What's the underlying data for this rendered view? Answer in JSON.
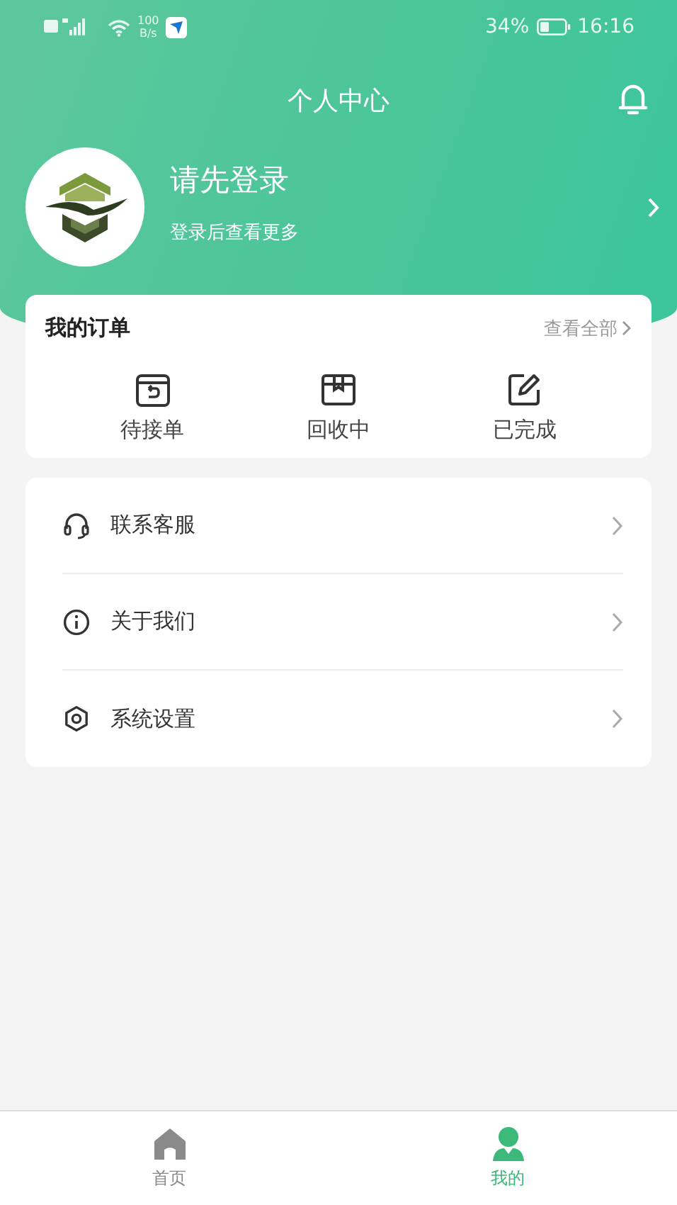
{
  "status_bar": {
    "speed": "100",
    "speed_unit": "B/s",
    "battery": "34%",
    "time": "16:16"
  },
  "header": {
    "title": "个人中心"
  },
  "profile": {
    "name": "请先登录",
    "hint": "登录后查看更多"
  },
  "orders": {
    "title": "我的订单",
    "view_all": "查看全部",
    "items": [
      {
        "label": "待接单",
        "kind": "pending"
      },
      {
        "label": "回收中",
        "kind": "package"
      },
      {
        "label": "已完成",
        "kind": "done"
      }
    ]
  },
  "menu": [
    {
      "label": "联系客服",
      "kind": "headset"
    },
    {
      "label": "关于我们",
      "kind": "info"
    },
    {
      "label": "系统设置",
      "kind": "gear"
    }
  ],
  "tab_bar": [
    {
      "label": "首页",
      "kind": "home",
      "selected": false
    },
    {
      "label": "我的",
      "kind": "user",
      "selected": true
    }
  ]
}
